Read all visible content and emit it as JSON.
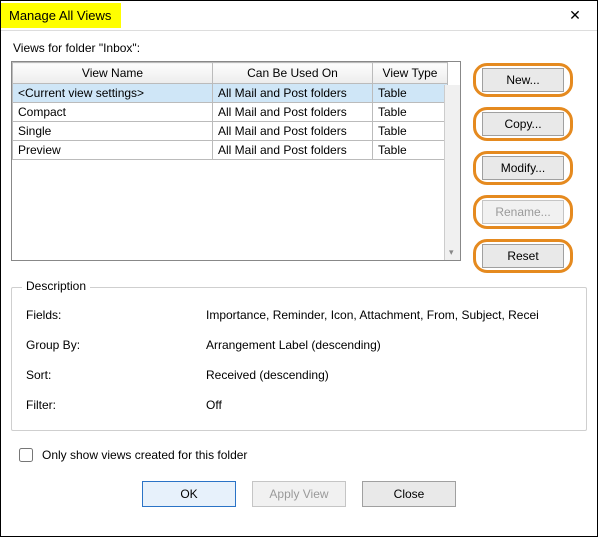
{
  "titlebar": {
    "title": "Manage All Views",
    "close": "✕"
  },
  "folder_label": "Views for folder \"Inbox\":",
  "columns": {
    "name": "View Name",
    "used_on": "Can Be Used On",
    "type": "View Type"
  },
  "rows": [
    {
      "name": "<Current view settings>",
      "used_on": "All Mail and Post folders",
      "type": "Table",
      "selected": true
    },
    {
      "name": "Compact",
      "used_on": "All Mail and Post folders",
      "type": "Table",
      "selected": false
    },
    {
      "name": "Single",
      "used_on": "All Mail and Post folders",
      "type": "Table",
      "selected": false
    },
    {
      "name": "Preview",
      "used_on": "All Mail and Post folders",
      "type": "Table",
      "selected": false
    }
  ],
  "side": {
    "new": "New...",
    "copy": "Copy...",
    "modify": "Modify...",
    "rename": "Rename...",
    "reset": "Reset"
  },
  "description": {
    "legend": "Description",
    "fields_label": "Fields:",
    "fields_value": "Importance, Reminder, Icon, Attachment, From, Subject, Recei",
    "group_label": "Group By:",
    "group_value": "Arrangement Label (descending)",
    "sort_label": "Sort:",
    "sort_value": "Received (descending)",
    "filter_label": "Filter:",
    "filter_value": "Off"
  },
  "checkbox_label": "Only show views created for this folder",
  "footer": {
    "ok": "OK",
    "apply": "Apply View",
    "close": "Close"
  }
}
